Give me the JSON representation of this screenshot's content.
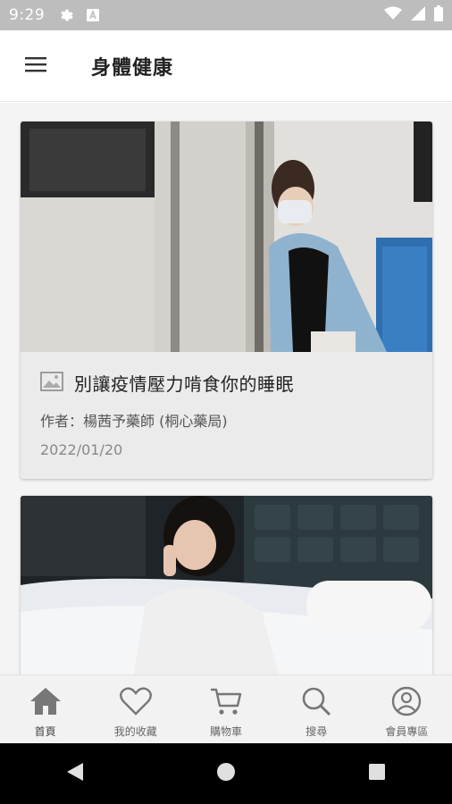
{
  "status_bar": {
    "time": "9:29",
    "icons": [
      "gear-icon",
      "a-badge-icon",
      "wifi-icon",
      "signal-icon",
      "battery-icon"
    ]
  },
  "app_bar": {
    "title": "身體健康",
    "menu_icon": "hamburger-menu-icon"
  },
  "articles": [
    {
      "title": "別讓疫情壓力啃食你的睡眠",
      "author": "作者：楊茜予藥師 (桐心藥局)",
      "date": "2022/01/20",
      "image": "woman-wearing-mask-on-train-photo"
    },
    {
      "image": "woman-sitting-on-bed-at-night-photo"
    }
  ],
  "bottom_nav": {
    "items": [
      {
        "label": "首頁",
        "icon": "home-icon",
        "active": true
      },
      {
        "label": "我的收藏",
        "icon": "heart-icon"
      },
      {
        "label": "購物車",
        "icon": "cart-icon"
      },
      {
        "label": "搜尋",
        "icon": "search-icon"
      },
      {
        "label": "會員專區",
        "icon": "account-icon"
      }
    ]
  },
  "system_nav": [
    "back-icon",
    "home-circle-icon",
    "recents-icon"
  ],
  "colors": {
    "status_bar": "#bdbdbd",
    "card_background": "#ebebeb",
    "bottom_nav_background": "#f2f2f2",
    "icon_gray": "#777777"
  }
}
